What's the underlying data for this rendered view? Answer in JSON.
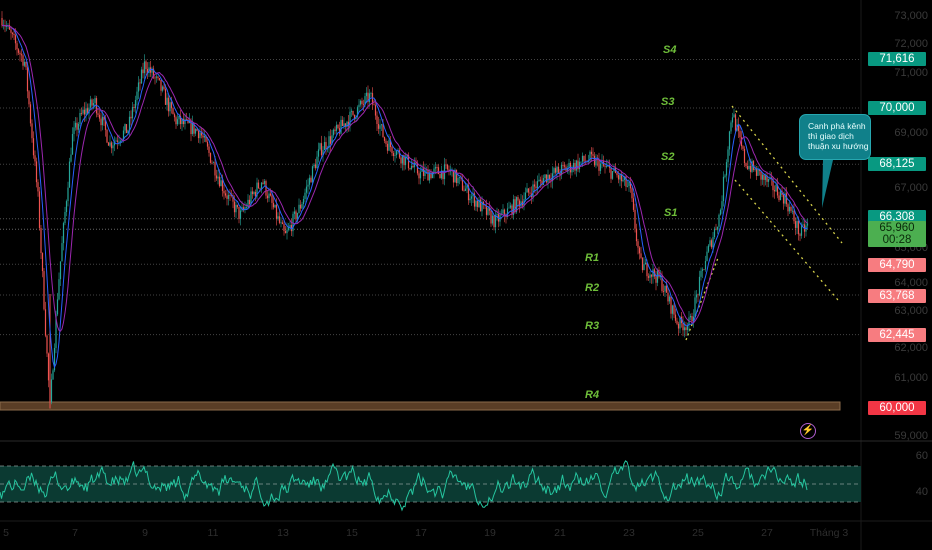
{
  "colors": {
    "up": "#26a69a",
    "down": "#ef5350",
    "ma_fast": "#2962ff",
    "ma_slow": "#9c27b0",
    "support_tag": "#089981",
    "resist_tag": "#f77c80",
    "level_text": "#6fbf3a"
  },
  "price_axis": {
    "ticks": [
      "73,000",
      "72,000",
      "71,000",
      "69,000",
      "67,000",
      "65,000",
      "64,000",
      "63,000",
      "62,000",
      "61,000",
      "59,000"
    ]
  },
  "price_tags": [
    {
      "name": "s4",
      "value": "71,616",
      "kind": "support"
    },
    {
      "name": "s3",
      "value": "70,000",
      "kind": "support"
    },
    {
      "name": "s2",
      "value": "68,125",
      "kind": "support"
    },
    {
      "name": "s1",
      "value": "66,308",
      "kind": "support"
    },
    {
      "name": "r1",
      "value": "64,790",
      "kind": "resist"
    },
    {
      "name": "r2",
      "value": "63,768",
      "kind": "resist"
    },
    {
      "name": "r3",
      "value": "62,445",
      "kind": "resist"
    },
    {
      "name": "r4",
      "value": "60,000",
      "kind": "strong"
    }
  ],
  "last_price": {
    "value": "65,960",
    "countdown": "00:28"
  },
  "levels": {
    "s4": "S4",
    "s3": "S3",
    "s2": "S2",
    "s1": "S1",
    "r1": "R1",
    "r2": "R2",
    "r3": "R3",
    "r4": "R4"
  },
  "callout": {
    "text": "Canh phá kênh thì giao dịch thuận xu hướng"
  },
  "rsi_axis": {
    "upper": "60",
    "lower": "40"
  },
  "time_axis": [
    "5",
    "7",
    "9",
    "11",
    "13",
    "15",
    "17",
    "19",
    "21",
    "23",
    "25",
    "27",
    "Tháng 3"
  ],
  "indicator_icon": "lightning-icon"
}
